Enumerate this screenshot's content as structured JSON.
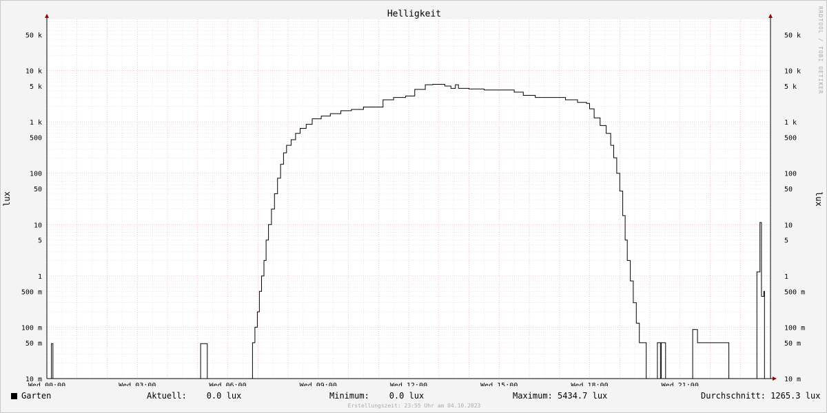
{
  "chart_data": {
    "type": "line",
    "title": "Helligkeit",
    "ylabel": "lux",
    "yscale": "log",
    "ylim": [
      0.01,
      100000
    ],
    "grid": true,
    "y_ticks": [
      {
        "value": 0.01,
        "label": "10 m"
      },
      {
        "value": 0.05,
        "label": "50 m"
      },
      {
        "value": 0.1,
        "label": "100 m"
      },
      {
        "value": 0.5,
        "label": "500 m"
      },
      {
        "value": 1,
        "label": "1"
      },
      {
        "value": 5,
        "label": "5"
      },
      {
        "value": 10,
        "label": "10"
      },
      {
        "value": 50,
        "label": "50"
      },
      {
        "value": 100,
        "label": "100"
      },
      {
        "value": 500,
        "label": "500"
      },
      {
        "value": 1000,
        "label": "1 k"
      },
      {
        "value": 5000,
        "label": "5 k"
      },
      {
        "value": 10000,
        "label": "10 k"
      },
      {
        "value": 50000,
        "label": "50 k"
      }
    ],
    "x_ticks": [
      {
        "hour": 0,
        "label": "Wed 00:00"
      },
      {
        "hour": 3,
        "label": "Wed 03:00"
      },
      {
        "hour": 6,
        "label": "Wed 06:00"
      },
      {
        "hour": 9,
        "label": "Wed 09:00"
      },
      {
        "hour": 12,
        "label": "Wed 12:00"
      },
      {
        "hour": 15,
        "label": "Wed 15:00"
      },
      {
        "hour": 18,
        "label": "Wed 18:00"
      },
      {
        "hour": 21,
        "label": "Wed 21:00"
      }
    ],
    "xlim_hours": [
      0,
      24
    ],
    "series": [
      {
        "name": "Garten",
        "color": "#000000",
        "points": [
          [
            0.0,
            0.01
          ],
          [
            0.13,
            0.01
          ],
          [
            0.15,
            0.048
          ],
          [
            0.19,
            0.048
          ],
          [
            0.2,
            0.01
          ],
          [
            5.08,
            0.01
          ],
          [
            5.1,
            0.048
          ],
          [
            5.3,
            0.048
          ],
          [
            5.32,
            0.01
          ],
          [
            6.8,
            0.01
          ],
          [
            6.82,
            0.05
          ],
          [
            6.9,
            0.1
          ],
          [
            6.98,
            0.2
          ],
          [
            7.05,
            0.5
          ],
          [
            7.12,
            1
          ],
          [
            7.2,
            2
          ],
          [
            7.27,
            5
          ],
          [
            7.35,
            10
          ],
          [
            7.45,
            20
          ],
          [
            7.55,
            40
          ],
          [
            7.65,
            80
          ],
          [
            7.75,
            150
          ],
          [
            7.85,
            250
          ],
          [
            7.95,
            350
          ],
          [
            8.1,
            450
          ],
          [
            8.25,
            600
          ],
          [
            8.4,
            750
          ],
          [
            8.6,
            900
          ],
          [
            8.8,
            1150
          ],
          [
            9.1,
            1300
          ],
          [
            9.4,
            1450
          ],
          [
            9.75,
            1650
          ],
          [
            10.1,
            1750
          ],
          [
            10.5,
            1950
          ],
          [
            11.0,
            1950
          ],
          [
            11.15,
            2700
          ],
          [
            11.5,
            3000
          ],
          [
            11.9,
            3200
          ],
          [
            12.2,
            4300
          ],
          [
            12.55,
            5300
          ],
          [
            12.8,
            5400
          ],
          [
            13.2,
            5000
          ],
          [
            13.4,
            4500
          ],
          [
            13.55,
            5300
          ],
          [
            13.65,
            4500
          ],
          [
            14.0,
            4400
          ],
          [
            14.5,
            4200
          ],
          [
            15.0,
            4200
          ],
          [
            15.5,
            3800
          ],
          [
            15.8,
            3300
          ],
          [
            16.2,
            3000
          ],
          [
            16.8,
            3000
          ],
          [
            17.2,
            2700
          ],
          [
            17.6,
            2400
          ],
          [
            17.9,
            2300
          ],
          [
            18.0,
            1800
          ],
          [
            18.15,
            1200
          ],
          [
            18.35,
            850
          ],
          [
            18.55,
            600
          ],
          [
            18.7,
            350
          ],
          [
            18.8,
            200
          ],
          [
            18.9,
            100
          ],
          [
            19.0,
            45
          ],
          [
            19.1,
            15
          ],
          [
            19.18,
            5
          ],
          [
            19.25,
            2
          ],
          [
            19.35,
            0.8
          ],
          [
            19.45,
            0.3
          ],
          [
            19.55,
            0.12
          ],
          [
            19.65,
            0.05
          ],
          [
            19.85,
            0.05
          ],
          [
            19.88,
            0.01
          ],
          [
            20.22,
            0.01
          ],
          [
            20.25,
            0.05
          ],
          [
            20.32,
            0.05
          ],
          [
            20.35,
            0.01
          ],
          [
            20.38,
            0.05
          ],
          [
            20.5,
            0.05
          ],
          [
            20.52,
            0.01
          ],
          [
            21.4,
            0.01
          ],
          [
            21.42,
            0.09
          ],
          [
            21.55,
            0.09
          ],
          [
            21.58,
            0.05
          ],
          [
            22.6,
            0.05
          ],
          [
            22.62,
            0.01
          ],
          [
            23.5,
            0.01
          ],
          [
            23.55,
            1.2
          ],
          [
            23.65,
            11
          ],
          [
            23.7,
            0.4
          ],
          [
            23.78,
            0.5
          ],
          [
            23.8,
            0.01
          ],
          [
            24.0,
            0.01
          ]
        ]
      }
    ]
  },
  "legend": {
    "series_name": "Garten",
    "aktuell": "Aktuell:    0.0 lux",
    "minimum": "Minimum:    0.0 lux",
    "maximum": "Maximum: 5434.7 lux",
    "durchschnitt": "Durchschnitt: 1265.3 lux"
  },
  "footer_created": "Erstellungszeit: 23:55 Uhr am 04.10.2023",
  "watermark": "RRDTOOL / TOBI OETIKER"
}
